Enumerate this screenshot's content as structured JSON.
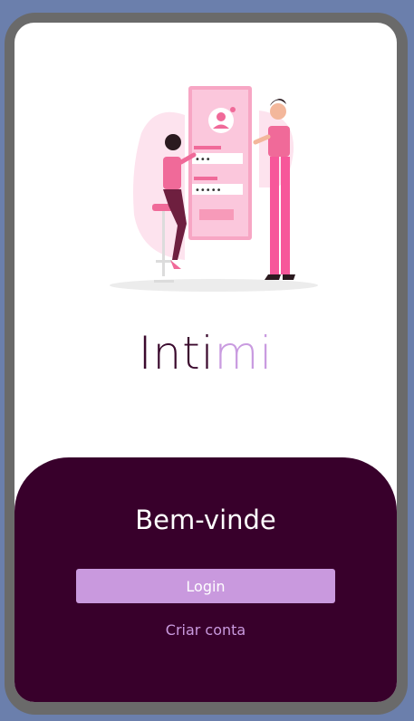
{
  "brand": {
    "name_part1": "Inti",
    "name_part2": "mi"
  },
  "illustration": {
    "icon": "login-illustration",
    "password_mask_1": "•••",
    "password_mask_2": "•••••"
  },
  "welcome": {
    "title": "Bem-vinde"
  },
  "actions": {
    "login_label": "Login",
    "create_account_label": "Criar conta"
  },
  "colors": {
    "background": "#6b7fac",
    "panel": "#38002b",
    "accent": "#c999de",
    "brand_dark": "#3b0a2e"
  }
}
